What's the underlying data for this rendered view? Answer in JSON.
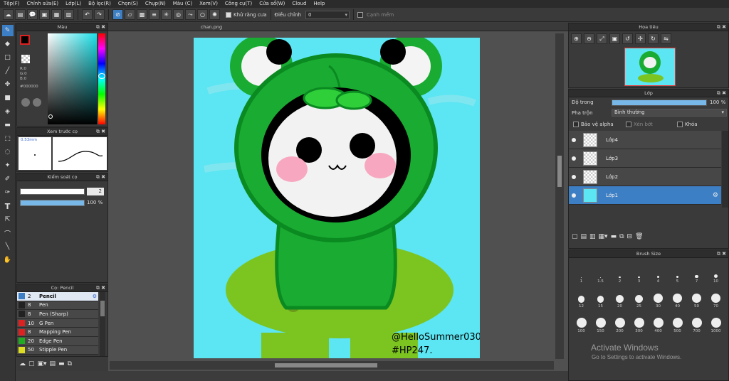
{
  "menu": [
    "Tệp(F)",
    "Chỉnh sửa(E)",
    "Lớp(L)",
    "Bộ lọc(R)",
    "Chọn(S)",
    "Chụp(N)",
    "Màu (C)",
    "Xem(V)",
    "Công cụ(T)",
    "Cửa sổ(W)",
    "Cloud",
    "Help"
  ],
  "toolbar": {
    "antialias_label": "Khử răng cưa",
    "adjust_label": "Điều chỉnh",
    "adjust_value": "0",
    "smooth_label": "Cạnh mềm"
  },
  "color_panel": {
    "title": "Màu",
    "r": "R:0",
    "g": "G:0",
    "b": "B:0",
    "hex": "#000000"
  },
  "preview_panel": {
    "title": "Xem trước cọ",
    "size": "0.53mm"
  },
  "brush_ctrl": {
    "title": "Kiểm soát cọ",
    "size": "2",
    "opacity": "100 %"
  },
  "brush_list": {
    "title": "Cọ: Pencil",
    "items": [
      {
        "size": "2",
        "name": "Pencil",
        "color": "#3d7fc4"
      },
      {
        "size": "8",
        "name": "Pen",
        "color": "#222222"
      },
      {
        "size": "8",
        "name": "Pen (Sharp)",
        "color": "#222222"
      },
      {
        "size": "10",
        "name": "G Pen",
        "color": "#dd2222"
      },
      {
        "size": "8",
        "name": "Mapping Pen",
        "color": "#dd2222"
      },
      {
        "size": "20",
        "name": "Edge Pen",
        "color": "#22aa22"
      },
      {
        "size": "50",
        "name": "Stipple Pen",
        "color": "#dddd22"
      }
    ]
  },
  "canvas": {
    "tab": "chan.png",
    "signature1": "@HelloSummer0304",
    "signature2": "#HP247."
  },
  "navigator": {
    "title": "Họa tiêu"
  },
  "layers": {
    "title": "Lớp",
    "opacity_label": "Độ trong",
    "opacity_value": "100 %",
    "blend_label": "Pha trộn",
    "blend_value": "Bình thường",
    "protect_alpha": "Bảo vệ alpha",
    "clip": "Xén bớt",
    "lock": "Khóa",
    "items": [
      {
        "name": "Lớp4"
      },
      {
        "name": "Lớp3"
      },
      {
        "name": "Lớp2"
      },
      {
        "name": "Lớp1"
      }
    ]
  },
  "brush_size": {
    "title": "Brush Size",
    "rows": [
      [
        "1",
        "1.5",
        "2",
        "3",
        "4",
        "5",
        "7",
        "10"
      ],
      [
        "12",
        "15",
        "20",
        "25",
        "30",
        "40",
        "50",
        "70"
      ],
      [
        "100",
        "150",
        "200",
        "300",
        "400",
        "500",
        "700",
        "1000"
      ]
    ]
  },
  "watermark": {
    "line1": "Activate Windows",
    "line2": "Go to Settings to activate Windows."
  }
}
